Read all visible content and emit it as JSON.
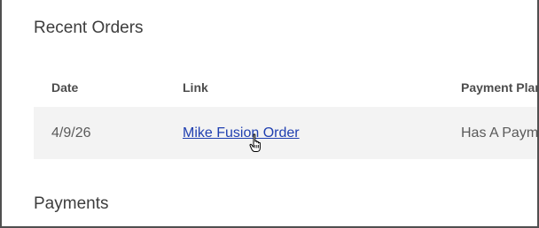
{
  "recent_orders": {
    "title": "Recent Orders",
    "columns": [
      "Date",
      "Link",
      "Payment Plan"
    ],
    "rows": [
      {
        "date": "4/9/26",
        "link_text": "Mike Fusion Order",
        "payment_plan": "Has A Payment Plan"
      }
    ]
  },
  "payments": {
    "title": "Payments"
  },
  "cursor": {
    "icon": "hand-pointer-icon"
  }
}
